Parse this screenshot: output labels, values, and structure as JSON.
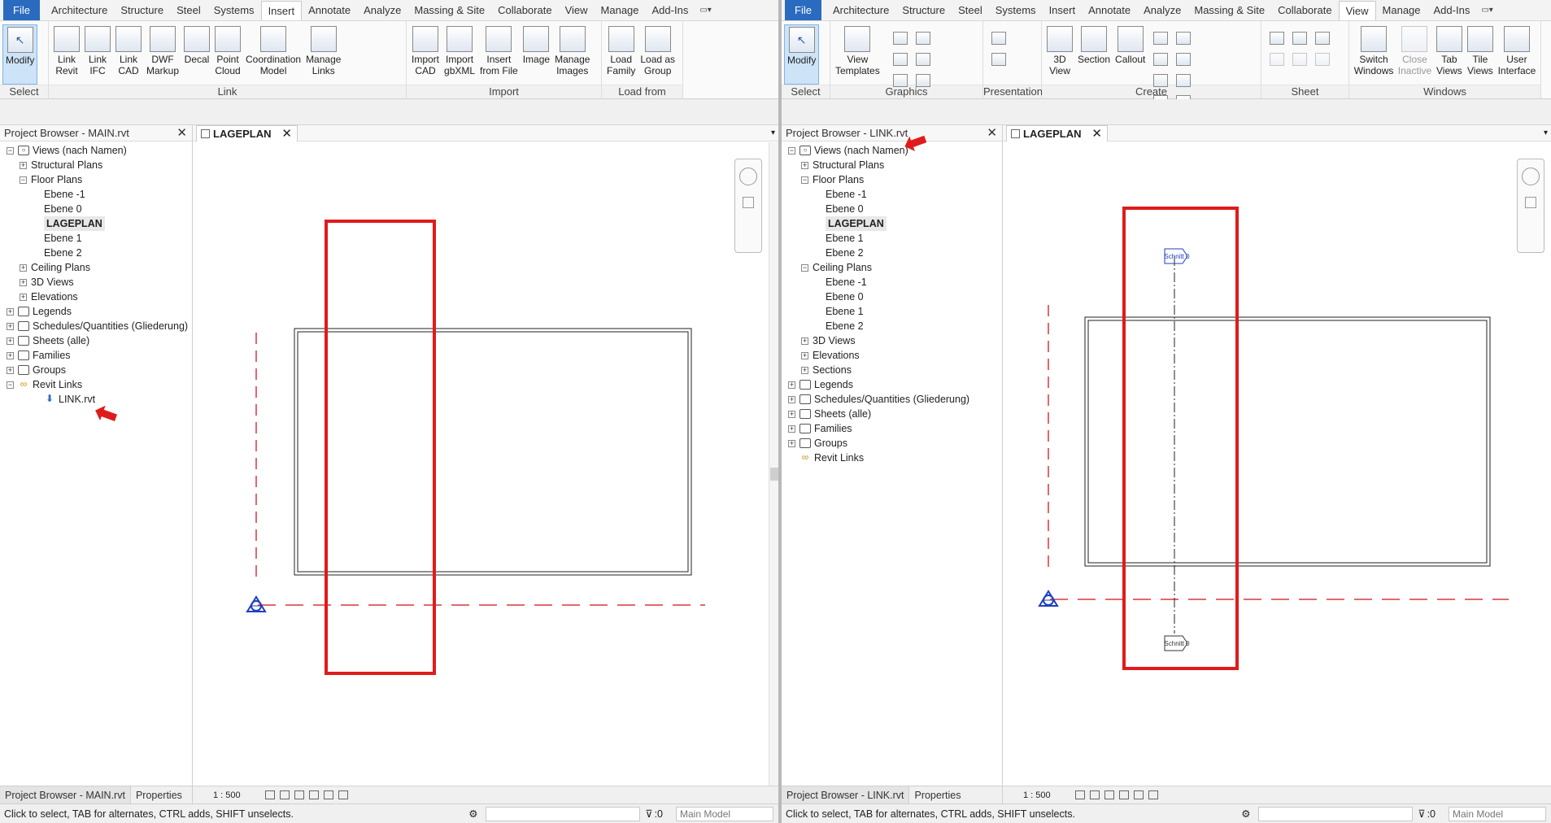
{
  "left": {
    "tabs": [
      "File",
      "Architecture",
      "Structure",
      "Steel",
      "Systems",
      "Insert",
      "Annotate",
      "Analyze",
      "Massing & Site",
      "Collaborate",
      "View",
      "Manage",
      "Add-Ins"
    ],
    "active_tab": "Insert",
    "ribbon": {
      "select": {
        "label": "Modify",
        "title": "Select"
      },
      "link": {
        "title": "Link",
        "buttons": [
          "Link\nRevit",
          "Link\nIFC",
          "Link\nCAD",
          "DWF\nMarkup",
          "Decal",
          "Point\nCloud",
          "Coordination\nModel",
          "Manage\nLinks"
        ]
      },
      "import": {
        "title": "Import",
        "buttons": [
          "Import\nCAD",
          "Import\ngbXML",
          "Insert\nfrom File",
          "Image",
          "Manage\nImages"
        ]
      },
      "library": {
        "title": "Load from Library",
        "buttons": [
          "Load\nFamily",
          "Load as\nGroup"
        ]
      }
    },
    "browser": {
      "title": "Project Browser - MAIN.rvt",
      "tree": [
        {
          "label": "Views (nach Namen)",
          "level": 0,
          "toggle": "-",
          "icon": "views"
        },
        {
          "label": "Structural Plans",
          "level": 1,
          "toggle": "+"
        },
        {
          "label": "Floor Plans",
          "level": 1,
          "toggle": "-"
        },
        {
          "label": "Ebene -1",
          "level": 2
        },
        {
          "label": "Ebene 0",
          "level": 2
        },
        {
          "label": "LAGEPLAN",
          "level": 2,
          "bold": true
        },
        {
          "label": "Ebene 1",
          "level": 2
        },
        {
          "label": "Ebene 2",
          "level": 2
        },
        {
          "label": "Ceiling Plans",
          "level": 1,
          "toggle": "+"
        },
        {
          "label": "3D Views",
          "level": 1,
          "toggle": "+"
        },
        {
          "label": "Elevations",
          "level": 1,
          "toggle": "+"
        },
        {
          "label": "Legends",
          "level": 0,
          "toggle": "+",
          "icon": "legend"
        },
        {
          "label": "Schedules/Quantities (Gliederung)",
          "level": 0,
          "toggle": "+",
          "icon": "schedule"
        },
        {
          "label": "Sheets (alle)",
          "level": 0,
          "toggle": "+",
          "icon": "sheet"
        },
        {
          "label": "Families",
          "level": 0,
          "toggle": "+",
          "icon": "family"
        },
        {
          "label": "Groups",
          "level": 0,
          "toggle": "+",
          "icon": "group"
        },
        {
          "label": "Revit Links",
          "level": 0,
          "toggle": "-",
          "icon": "link"
        },
        {
          "label": "LINK.rvt",
          "level": 2,
          "icon": "file"
        }
      ],
      "bottom_tabs": [
        "Project Browser - MAIN.rvt",
        "Properties"
      ]
    },
    "view_tab": "LAGEPLAN",
    "scale": "1 : 500",
    "status": "Click to select, TAB for alternates, CTRL adds, SHIFT unselects.",
    "filter_count": ":0",
    "model": "Main Model"
  },
  "right": {
    "tabs": [
      "File",
      "Architecture",
      "Structure",
      "Steel",
      "Systems",
      "Insert",
      "Annotate",
      "Analyze",
      "Massing & Site",
      "Collaborate",
      "View",
      "Manage",
      "Add-Ins"
    ],
    "active_tab": "View",
    "ribbon": {
      "select": {
        "label": "Modify",
        "title": "Select"
      },
      "graphics": {
        "title": "Graphics",
        "buttons": [
          "View\nTemplates"
        ]
      },
      "presentation": {
        "title": "Presentation"
      },
      "create": {
        "title": "Create",
        "buttons": [
          "3D\nView",
          "Section",
          "Callout"
        ]
      },
      "sheet": {
        "title": "Sheet Composition"
      },
      "windows": {
        "title": "Windows",
        "buttons": [
          "Switch\nWindows",
          "Close\nInactive",
          "Tab\nViews",
          "Tile\nViews",
          "User\nInterface"
        ]
      }
    },
    "browser": {
      "title": "Project Browser - LINK.rvt",
      "tree": [
        {
          "label": "Views (nach Namen)",
          "level": 0,
          "toggle": "-",
          "icon": "views"
        },
        {
          "label": "Structural Plans",
          "level": 1,
          "toggle": "+"
        },
        {
          "label": "Floor Plans",
          "level": 1,
          "toggle": "-"
        },
        {
          "label": "Ebene -1",
          "level": 2
        },
        {
          "label": "Ebene 0",
          "level": 2
        },
        {
          "label": "LAGEPLAN",
          "level": 2,
          "bold": true
        },
        {
          "label": "Ebene 1",
          "level": 2
        },
        {
          "label": "Ebene 2",
          "level": 2
        },
        {
          "label": "Ceiling Plans",
          "level": 1,
          "toggle": "-"
        },
        {
          "label": "Ebene -1",
          "level": 2
        },
        {
          "label": "Ebene 0",
          "level": 2
        },
        {
          "label": "Ebene 1",
          "level": 2
        },
        {
          "label": "Ebene 2",
          "level": 2
        },
        {
          "label": "3D Views",
          "level": 1,
          "toggle": "+"
        },
        {
          "label": "Elevations",
          "level": 1,
          "toggle": "+"
        },
        {
          "label": "Sections",
          "level": 1,
          "toggle": "+"
        },
        {
          "label": "Legends",
          "level": 0,
          "toggle": "+",
          "icon": "legend"
        },
        {
          "label": "Schedules/Quantities (Gliederung)",
          "level": 0,
          "toggle": "+",
          "icon": "schedule"
        },
        {
          "label": "Sheets (alle)",
          "level": 0,
          "toggle": "+",
          "icon": "sheet"
        },
        {
          "label": "Families",
          "level": 0,
          "toggle": "+",
          "icon": "family"
        },
        {
          "label": "Groups",
          "level": 0,
          "toggle": "+",
          "icon": "group"
        },
        {
          "label": "Revit Links",
          "level": 0,
          "icon": "link"
        }
      ],
      "bottom_tabs": [
        "Project Browser - LINK.rvt",
        "Properties"
      ]
    },
    "view_tab": "LAGEPLAN",
    "scale": "1 : 500",
    "section_label": "Schnitt 0",
    "status": "Click to select, TAB for alternates, CTRL adds, SHIFT unselects.",
    "filter_count": ":0",
    "model": "Main Model"
  },
  "colors": {
    "accent": "#2a6bbf",
    "annotation": "#e01b1b",
    "datum": "#d9363e"
  }
}
